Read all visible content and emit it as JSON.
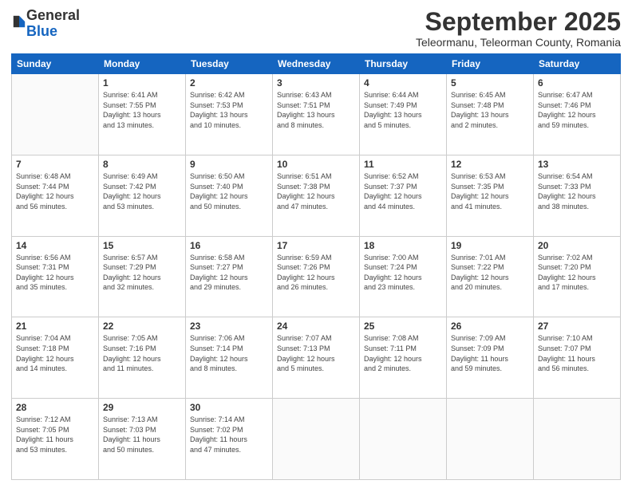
{
  "header": {
    "logo_general": "General",
    "logo_blue": "Blue",
    "month": "September 2025",
    "location": "Teleormanu, Teleorman County, Romania"
  },
  "weekdays": [
    "Sunday",
    "Monday",
    "Tuesday",
    "Wednesday",
    "Thursday",
    "Friday",
    "Saturday"
  ],
  "weeks": [
    [
      {
        "day": "",
        "info": ""
      },
      {
        "day": "1",
        "info": "Sunrise: 6:41 AM\nSunset: 7:55 PM\nDaylight: 13 hours\nand 13 minutes."
      },
      {
        "day": "2",
        "info": "Sunrise: 6:42 AM\nSunset: 7:53 PM\nDaylight: 13 hours\nand 10 minutes."
      },
      {
        "day": "3",
        "info": "Sunrise: 6:43 AM\nSunset: 7:51 PM\nDaylight: 13 hours\nand 8 minutes."
      },
      {
        "day": "4",
        "info": "Sunrise: 6:44 AM\nSunset: 7:49 PM\nDaylight: 13 hours\nand 5 minutes."
      },
      {
        "day": "5",
        "info": "Sunrise: 6:45 AM\nSunset: 7:48 PM\nDaylight: 13 hours\nand 2 minutes."
      },
      {
        "day": "6",
        "info": "Sunrise: 6:47 AM\nSunset: 7:46 PM\nDaylight: 12 hours\nand 59 minutes."
      }
    ],
    [
      {
        "day": "7",
        "info": "Sunrise: 6:48 AM\nSunset: 7:44 PM\nDaylight: 12 hours\nand 56 minutes."
      },
      {
        "day": "8",
        "info": "Sunrise: 6:49 AM\nSunset: 7:42 PM\nDaylight: 12 hours\nand 53 minutes."
      },
      {
        "day": "9",
        "info": "Sunrise: 6:50 AM\nSunset: 7:40 PM\nDaylight: 12 hours\nand 50 minutes."
      },
      {
        "day": "10",
        "info": "Sunrise: 6:51 AM\nSunset: 7:38 PM\nDaylight: 12 hours\nand 47 minutes."
      },
      {
        "day": "11",
        "info": "Sunrise: 6:52 AM\nSunset: 7:37 PM\nDaylight: 12 hours\nand 44 minutes."
      },
      {
        "day": "12",
        "info": "Sunrise: 6:53 AM\nSunset: 7:35 PM\nDaylight: 12 hours\nand 41 minutes."
      },
      {
        "day": "13",
        "info": "Sunrise: 6:54 AM\nSunset: 7:33 PM\nDaylight: 12 hours\nand 38 minutes."
      }
    ],
    [
      {
        "day": "14",
        "info": "Sunrise: 6:56 AM\nSunset: 7:31 PM\nDaylight: 12 hours\nand 35 minutes."
      },
      {
        "day": "15",
        "info": "Sunrise: 6:57 AM\nSunset: 7:29 PM\nDaylight: 12 hours\nand 32 minutes."
      },
      {
        "day": "16",
        "info": "Sunrise: 6:58 AM\nSunset: 7:27 PM\nDaylight: 12 hours\nand 29 minutes."
      },
      {
        "day": "17",
        "info": "Sunrise: 6:59 AM\nSunset: 7:26 PM\nDaylight: 12 hours\nand 26 minutes."
      },
      {
        "day": "18",
        "info": "Sunrise: 7:00 AM\nSunset: 7:24 PM\nDaylight: 12 hours\nand 23 minutes."
      },
      {
        "day": "19",
        "info": "Sunrise: 7:01 AM\nSunset: 7:22 PM\nDaylight: 12 hours\nand 20 minutes."
      },
      {
        "day": "20",
        "info": "Sunrise: 7:02 AM\nSunset: 7:20 PM\nDaylight: 12 hours\nand 17 minutes."
      }
    ],
    [
      {
        "day": "21",
        "info": "Sunrise: 7:04 AM\nSunset: 7:18 PM\nDaylight: 12 hours\nand 14 minutes."
      },
      {
        "day": "22",
        "info": "Sunrise: 7:05 AM\nSunset: 7:16 PM\nDaylight: 12 hours\nand 11 minutes."
      },
      {
        "day": "23",
        "info": "Sunrise: 7:06 AM\nSunset: 7:14 PM\nDaylight: 12 hours\nand 8 minutes."
      },
      {
        "day": "24",
        "info": "Sunrise: 7:07 AM\nSunset: 7:13 PM\nDaylight: 12 hours\nand 5 minutes."
      },
      {
        "day": "25",
        "info": "Sunrise: 7:08 AM\nSunset: 7:11 PM\nDaylight: 12 hours\nand 2 minutes."
      },
      {
        "day": "26",
        "info": "Sunrise: 7:09 AM\nSunset: 7:09 PM\nDaylight: 11 hours\nand 59 minutes."
      },
      {
        "day": "27",
        "info": "Sunrise: 7:10 AM\nSunset: 7:07 PM\nDaylight: 11 hours\nand 56 minutes."
      }
    ],
    [
      {
        "day": "28",
        "info": "Sunrise: 7:12 AM\nSunset: 7:05 PM\nDaylight: 11 hours\nand 53 minutes."
      },
      {
        "day": "29",
        "info": "Sunrise: 7:13 AM\nSunset: 7:03 PM\nDaylight: 11 hours\nand 50 minutes."
      },
      {
        "day": "30",
        "info": "Sunrise: 7:14 AM\nSunset: 7:02 PM\nDaylight: 11 hours\nand 47 minutes."
      },
      {
        "day": "",
        "info": ""
      },
      {
        "day": "",
        "info": ""
      },
      {
        "day": "",
        "info": ""
      },
      {
        "day": "",
        "info": ""
      }
    ]
  ]
}
